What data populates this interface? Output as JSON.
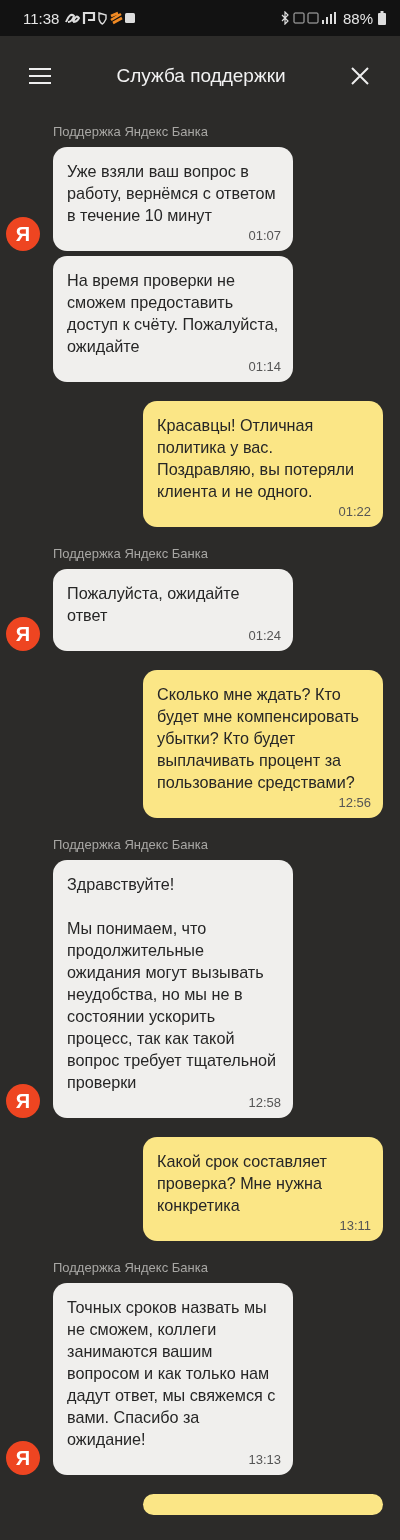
{
  "status_bar": {
    "time": "11:38",
    "battery": "88%"
  },
  "header": {
    "title": "Служба поддержки"
  },
  "groups": [
    {
      "kind": "support",
      "sender": "Поддержка Яндекс Банка",
      "messages": [
        {
          "text": "Уже взяли ваш вопрос в работу, вернёмся с ответом в течение 10 минут",
          "time": "01:07",
          "avatar": "Я"
        },
        {
          "text": "На время проверки не сможем предоставить доступ к счёту. Пожалуйста, ожидайте",
          "time": "01:14"
        }
      ]
    },
    {
      "kind": "user",
      "messages": [
        {
          "text": "Красавцы! Отличная политика у вас. Поздравляю, вы потеряли клиента и не одного.",
          "time": "01:22"
        }
      ]
    },
    {
      "kind": "support",
      "sender": "Поддержка Яндекс Банка",
      "messages": [
        {
          "text": "Пожалуйста, ожидайте ответ",
          "time": "01:24",
          "avatar": "Я"
        }
      ]
    },
    {
      "kind": "user",
      "messages": [
        {
          "text": "Сколько мне ждать? Кто будет мне компенсировать убытки? Кто будет выплачивать процент за пользование средствами?",
          "time": "12:56"
        }
      ]
    },
    {
      "kind": "support",
      "sender": "Поддержка Яндекс Банка",
      "messages": [
        {
          "text": "Здравствуйте!\n\nМы понимаем, что продолжительные ожидания могут вызывать неудобства, но мы не в состоянии ускорить процесс, так как такой вопрос требует тщательной проверки",
          "time": "12:58",
          "avatar": "Я"
        }
      ]
    },
    {
      "kind": "user",
      "messages": [
        {
          "text": "Какой срок составляет проверка? Мне нужна конкретика",
          "time": "13:11"
        }
      ]
    },
    {
      "kind": "support",
      "sender": "Поддержка Яндекс Банка",
      "messages": [
        {
          "text": "Точных сроков назвать мы не сможем, коллеги занимаются вашим вопросом и как только нам дадут ответ, мы свяжемся с вами. Спасибо за ожидание!",
          "time": "13:13",
          "avatar": "Я"
        }
      ]
    },
    {
      "kind": "user",
      "cut_off": true
    }
  ]
}
